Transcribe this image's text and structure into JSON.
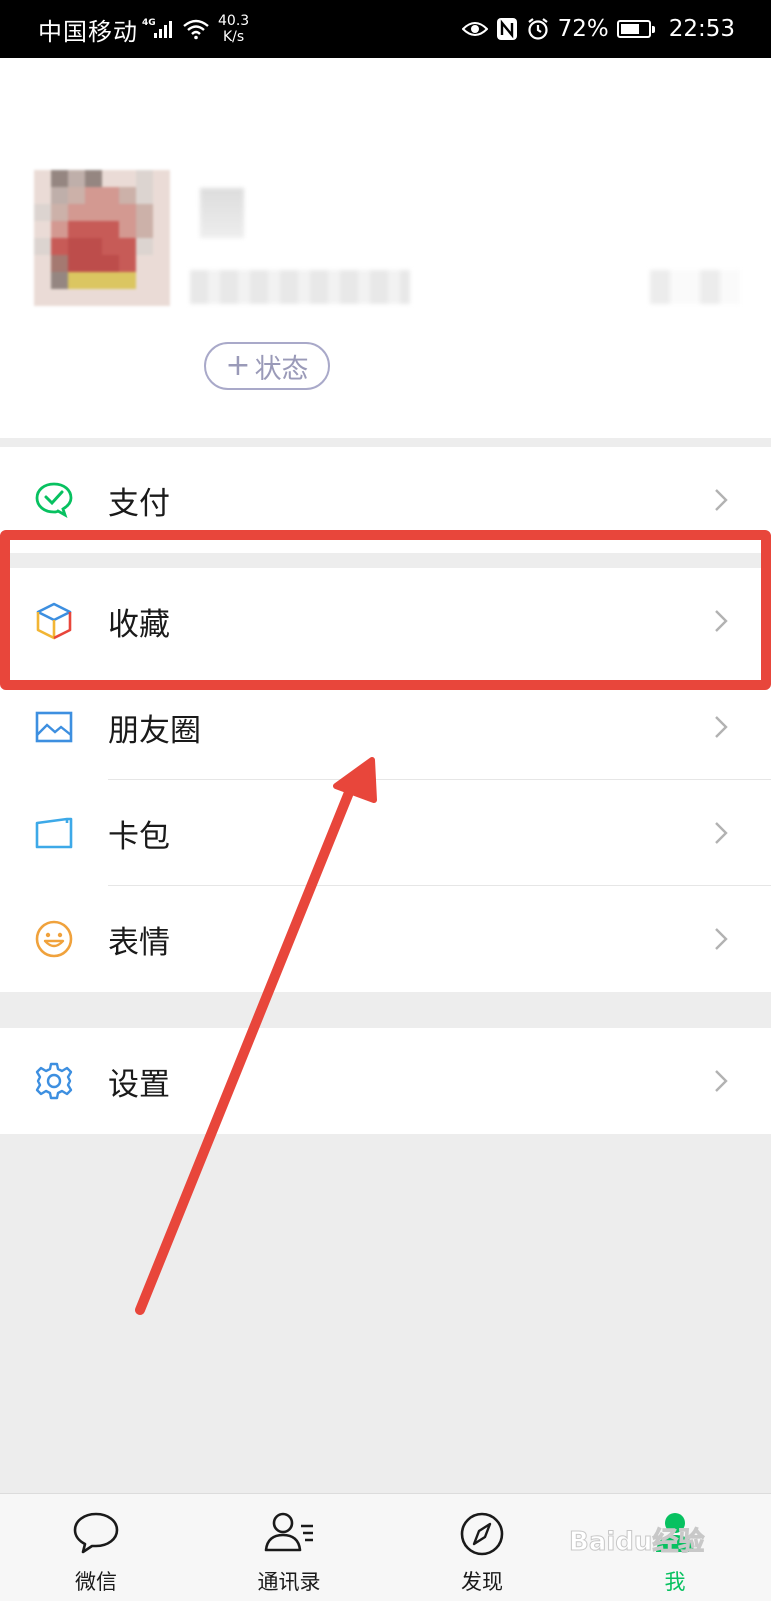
{
  "status_bar": {
    "carrier": "中国移动",
    "network": "4G",
    "speed_value": "40.3",
    "speed_unit": "K/s",
    "battery": "72%",
    "battery_level": 0.72,
    "time": "22:53"
  },
  "profile": {
    "status_button": "状态",
    "status_plus": "+"
  },
  "menu": {
    "pay": "支付",
    "favorites": "收藏",
    "moments": "朋友圈",
    "cards": "卡包",
    "stickers": "表情",
    "settings": "设置"
  },
  "tabs": [
    {
      "label": "微信",
      "icon": "chat-bubble-icon"
    },
    {
      "label": "通讯录",
      "icon": "contacts-icon"
    },
    {
      "label": "发现",
      "icon": "compass-icon"
    },
    {
      "label": "我",
      "icon": "me-icon"
    }
  ],
  "active_tab": "我",
  "watermark": "Baidu经验",
  "colors": {
    "accent_green": "#07c160",
    "highlight_red": "#e8463b",
    "background": "#ededed"
  }
}
